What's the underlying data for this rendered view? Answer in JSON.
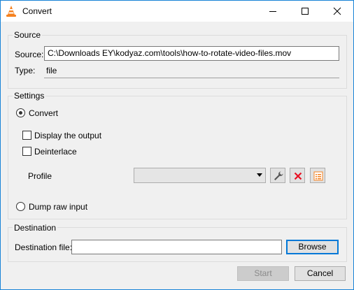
{
  "window": {
    "title": "Convert",
    "icon": "vlc-cone-icon"
  },
  "source": {
    "group_label": "Source",
    "source_label": "Source:",
    "source_value": "C:\\Downloads EY\\kodyaz.com\\tools\\how-to-rotate-video-files.mov",
    "type_label": "Type:",
    "type_value": "file"
  },
  "settings": {
    "group_label": "Settings",
    "convert_label": "Convert",
    "convert_selected": true,
    "display_output_label": "Display the output",
    "display_output_checked": false,
    "deinterlace_label": "Deinterlace",
    "deinterlace_checked": false,
    "profile_label": "Profile",
    "profile_value": "",
    "dump_raw_label": "Dump raw input",
    "dump_raw_selected": false
  },
  "destination": {
    "group_label": "Destination",
    "file_label": "Destination file:",
    "file_value": "",
    "browse_label": "Browse"
  },
  "footer": {
    "start_label": "Start",
    "cancel_label": "Cancel"
  },
  "colors": {
    "accent": "#0078d7",
    "delete_red": "#e81123",
    "window_bg": "#f0f0f0"
  }
}
